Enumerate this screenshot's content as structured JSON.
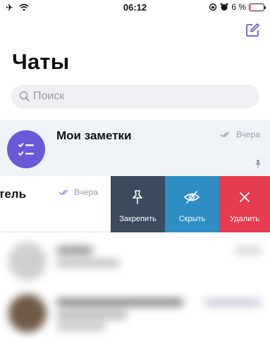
{
  "status_bar": {
    "time": "06:12",
    "battery_text": "6 %",
    "battery_level_percent": 6,
    "icons": [
      "airplane-icon",
      "wifi-icon",
      "orientation-lock-icon",
      "alarm-icon",
      "battery-icon"
    ]
  },
  "header": {
    "title": "Чаты",
    "compose_icon": "compose-icon"
  },
  "search": {
    "placeholder": "Поиск"
  },
  "chats": [
    {
      "name": "Мои заметки",
      "time": "Вчера",
      "pinned": true,
      "avatar_color": "#6a5ad8"
    },
    {
      "name": "тель",
      "time": "Вчера",
      "swiped": true
    }
  ],
  "swipe_actions": [
    {
      "label": "Закрепить",
      "icon": "pin-icon",
      "color": "#3b4a5e"
    },
    {
      "label": "Скрыть",
      "icon": "eye-off-icon",
      "color": "#2e8ec4"
    },
    {
      "label": "Удалить",
      "icon": "close-icon",
      "color": "#e63c4e"
    }
  ],
  "colors": {
    "accent": "#6a5ad8",
    "tick_color": "#8a8ad8",
    "pinned_row_bg": "#eef4f8"
  }
}
